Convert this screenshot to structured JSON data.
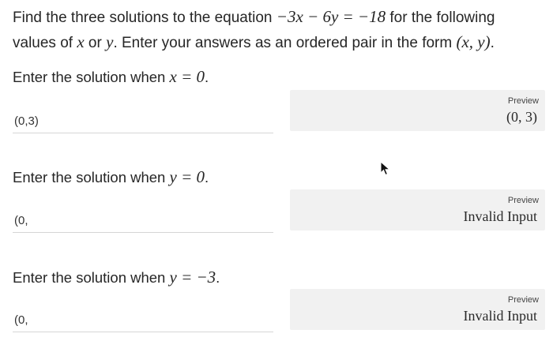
{
  "question": {
    "line1_pre": "Find the three solutions to the equation ",
    "equation": "−3x − 6y = −18",
    "line1_post": " for the following",
    "line2_pre": "values of ",
    "var_x": "x",
    "line2_or": " or ",
    "var_y": "y",
    "line2_post": ". Enter your answers as an ordered pair in the form ",
    "form": "(x, y)",
    "line2_end": "."
  },
  "parts": [
    {
      "label_pre": "Enter the solution when ",
      "label_math": "x = 0",
      "label_end": ".",
      "answer_value": "(0,3)",
      "preview_label": "Preview",
      "preview_value": "(0, 3)",
      "has_alert": false
    },
    {
      "label_pre": "Enter the solution when ",
      "label_math": "y = 0",
      "label_end": ".",
      "answer_value": "(0,",
      "preview_label": "Preview",
      "preview_value": "Invalid Input",
      "has_alert": true
    },
    {
      "label_pre": "Enter the solution when ",
      "label_math": "y = −3",
      "label_end": ".",
      "answer_value": "(0,",
      "preview_label": "Preview",
      "preview_value": "Invalid Input",
      "has_alert": true
    }
  ],
  "icons": {
    "alert": "alert-circle-icon",
    "alert_glyph": "!",
    "cursor": "mouse-pointer-icon"
  }
}
